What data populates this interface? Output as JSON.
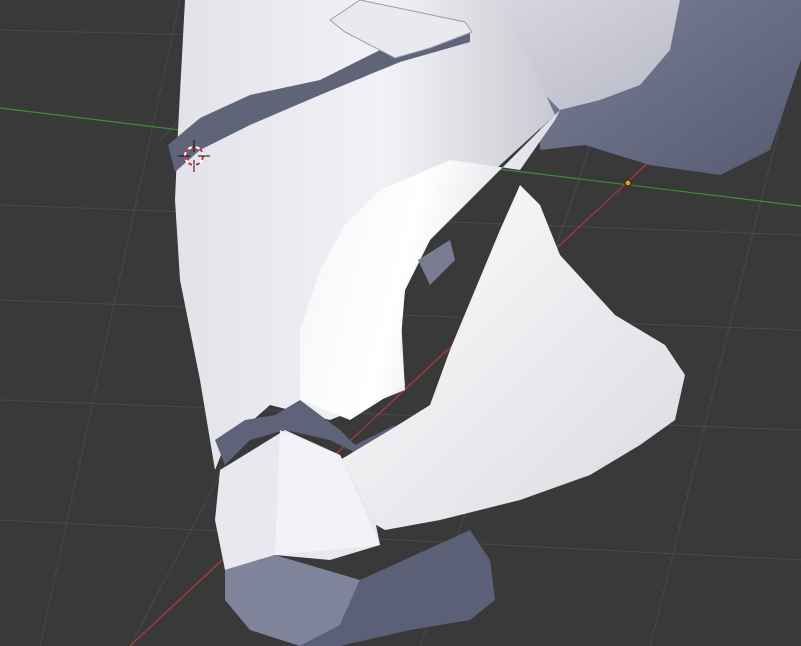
{
  "app": "3D viewport",
  "viewport": {
    "background_color": "#393939",
    "grid_line_color": "#4a4a4a",
    "x_axis_color": "#b03a3a",
    "y_axis_color": "#3f8a3f",
    "mesh_color": "#dcdce4",
    "mesh_shadow_color": "#6a6f86",
    "grid": true
  },
  "cursor_3d": {
    "icon": "3d-cursor-crosshair"
  },
  "object_origin": {
    "icon": "origin-dot",
    "color": "#e09a2a"
  }
}
